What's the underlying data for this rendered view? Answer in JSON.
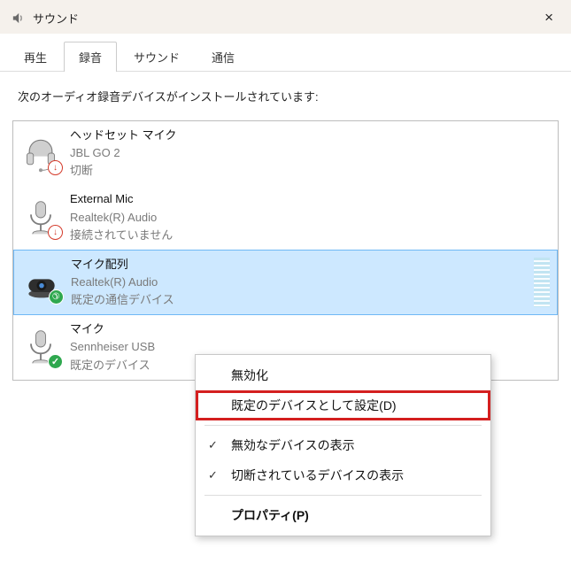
{
  "window": {
    "title": "サウンド",
    "close_label": "×"
  },
  "tabs": {
    "items": [
      {
        "label": "再生"
      },
      {
        "label": "録音",
        "active": true
      },
      {
        "label": "サウンド"
      },
      {
        "label": "通信"
      }
    ]
  },
  "prompt": "次のオーディオ録音デバイスがインストールされています:",
  "devices": [
    {
      "title": "ヘッドセット マイク",
      "sub": "JBL GO 2",
      "status": "切断",
      "icon": "headset",
      "badge": "down"
    },
    {
      "title": "External Mic",
      "sub": "Realtek(R) Audio",
      "status": "接続されていません",
      "icon": "standmic",
      "badge": "down"
    },
    {
      "title": "マイク配列",
      "sub": "Realtek(R) Audio",
      "status": "既定の通信デバイス",
      "icon": "webcam",
      "badge": "phone",
      "selected": true,
      "meter": true
    },
    {
      "title": "マイク",
      "sub": "Sennheiser USB",
      "status": "既定のデバイス",
      "icon": "standmic",
      "badge": "check"
    }
  ],
  "context_menu": {
    "items": [
      {
        "label": "無効化",
        "type": "item"
      },
      {
        "label": "既定のデバイスとして設定(D)",
        "type": "item",
        "highlighted": true
      },
      {
        "type": "sep"
      },
      {
        "label": "無効なデバイスの表示",
        "type": "item",
        "checked": true
      },
      {
        "label": "切断されているデバイスの表示",
        "type": "item",
        "checked": true
      },
      {
        "type": "sep"
      },
      {
        "label": "プロパティ(P)",
        "type": "item",
        "bold": true
      }
    ]
  }
}
